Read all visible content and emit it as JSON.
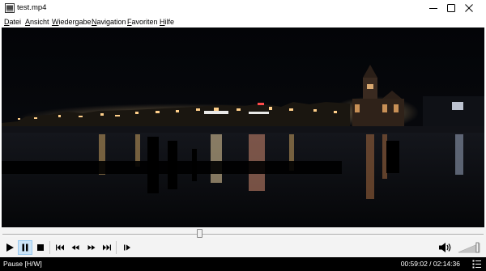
{
  "window": {
    "title": "test.mp4",
    "icons": [
      "app-icon",
      "minimize-icon",
      "maximize-icon",
      "close-icon"
    ]
  },
  "menu": {
    "items": [
      {
        "accel": "D",
        "rest": "atei"
      },
      {
        "accel": "A",
        "rest": "nsicht"
      },
      {
        "accel": "W",
        "rest": "iedergabe"
      },
      {
        "accel": "N",
        "rest": "avigation"
      },
      {
        "accel": "F",
        "rest": "avoriten"
      },
      {
        "accel": "H",
        "rest": "ilfe"
      }
    ]
  },
  "video": {
    "scene": "night harbor skyline with reflections",
    "colors": {
      "sky": "#05060a",
      "water": "#0a0c10",
      "lights": "#ffd08a"
    }
  },
  "seek": {
    "position_fraction": 0.41
  },
  "controls": {
    "buttons": [
      "play-icon",
      "pause-icon",
      "stop-icon",
      "skip-previous-icon",
      "rewind-icon",
      "fast-forward-icon",
      "skip-next-icon",
      "frame-step-icon"
    ],
    "active": "pause-icon",
    "volume_icon": "speaker-icon",
    "volume_level": 0.9
  },
  "status": {
    "state": "Pause [H/W]",
    "time": "00:59:02 / 02:14:36",
    "icon": "stats-icon"
  }
}
